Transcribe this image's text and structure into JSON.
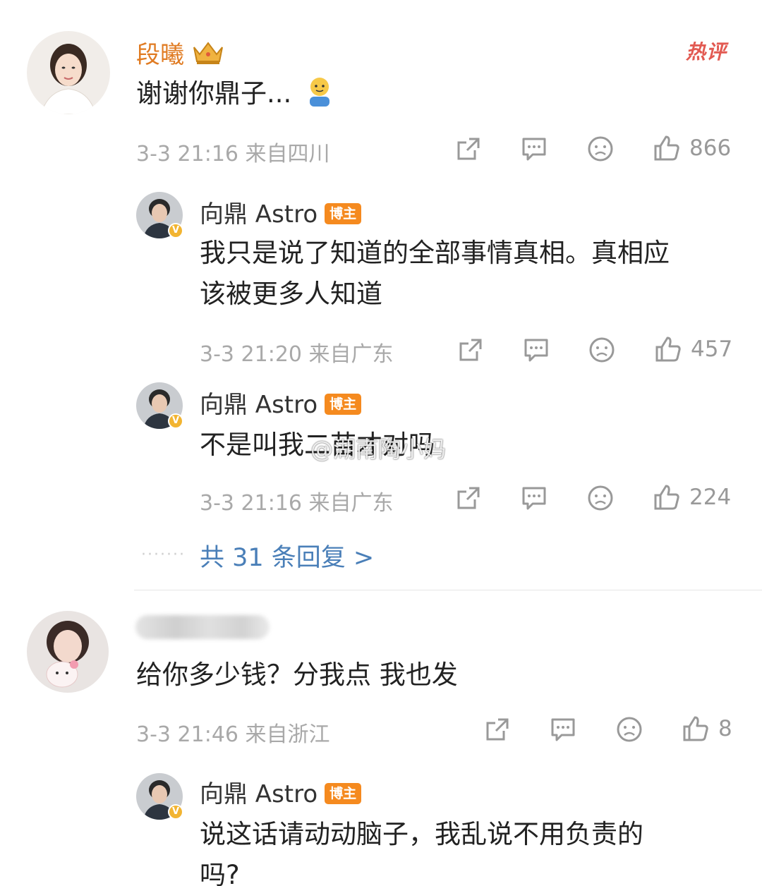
{
  "hot_label": "热评",
  "comment1": {
    "username": "段曦",
    "text": "谢谢你鼎子...",
    "meta": "3-3 21:16  来自四川",
    "likes": "866",
    "icons": [
      "share-icon",
      "comment-icon",
      "dislike-icon",
      "thumbs-up-icon"
    ]
  },
  "replies": [
    {
      "username": "向鼎 Astro",
      "badge": "博主",
      "text_line1": "我只是说了知道的全部事情真相。真相应",
      "text_line2": "该被更多人知道",
      "meta": "3-3 21:20  来自广东",
      "likes": "457"
    },
    {
      "username": "向鼎 Astro",
      "badge": "博主",
      "text_line1": "不是叫我二苗才对吗",
      "meta": "3-3 21:16  来自广东",
      "likes": "224"
    }
  ],
  "more_replies": "共 31 条回复 >",
  "watermark": "@湖南陶小妈",
  "comment2": {
    "text": "给你多少钱？分我点 我也发",
    "meta": "3-3 21:46  来自浙江",
    "likes": "8"
  },
  "reply3": {
    "username": "向鼎 Astro",
    "badge": "博主",
    "text_line1": "说这话请动动脑子，我乱说不用负责的",
    "text_line2": "吗?"
  },
  "colors": {
    "username_gold": "#e07b22",
    "badge_orange": "#f58a1f",
    "link_blue": "#4a7fb8",
    "meta_grey": "#a9a9a9"
  }
}
